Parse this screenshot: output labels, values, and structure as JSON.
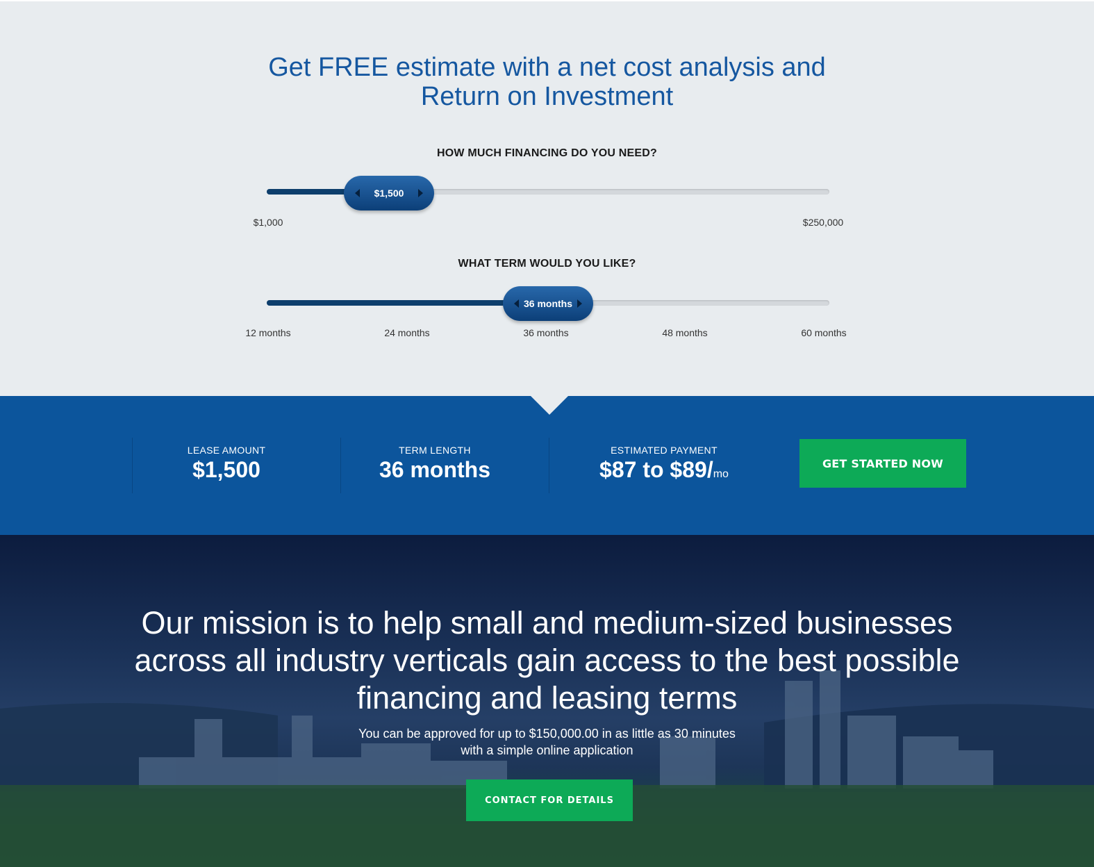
{
  "calculator": {
    "title_line1": "Get FREE estimate with a net cost analysis and",
    "title_line2": "Return on Investment",
    "financing": {
      "question": "HOW MUCH FINANCING DO YOU NEED?",
      "value_label": "$1,500",
      "min_label": "$1,000",
      "max_label": "$250,000",
      "value": 1500,
      "min": 1000,
      "max": 250000
    },
    "term": {
      "question": "WHAT TERM WOULD YOU LIKE?",
      "value_label": "36 months",
      "ticks": [
        "12 months",
        "24 months",
        "36 months",
        "48 months",
        "60 months"
      ],
      "value": 36,
      "min": 12,
      "max": 60
    }
  },
  "summary": {
    "lease_amount_label": "LEASE AMOUNT",
    "lease_amount_value": "$1,500",
    "term_length_label": "TERM LENGTH",
    "term_length_value": "36 months",
    "estimated_payment_label": "ESTIMATED PAYMENT",
    "estimated_payment_value": "$87 to $89/",
    "estimated_payment_unit": "mo",
    "cta_label": "GET STARTED NOW"
  },
  "hero": {
    "mission_line1": "Our mission is to help small and medium-sized businesses",
    "mission_line2": "across all industry verticals gain access to the best possible",
    "mission_line3": "financing and leasing terms",
    "sub_line1": "You can be approved for up to $150,000.00 in as little as 30 minutes",
    "sub_line2": "with a simple online application",
    "cta_label": "CONTACT FOR DETAILS"
  },
  "colors": {
    "brand_blue": "#0c559c",
    "title_blue": "#1557a0",
    "accent_green": "#0daa57",
    "slider_dark": "#0d3e6c"
  }
}
